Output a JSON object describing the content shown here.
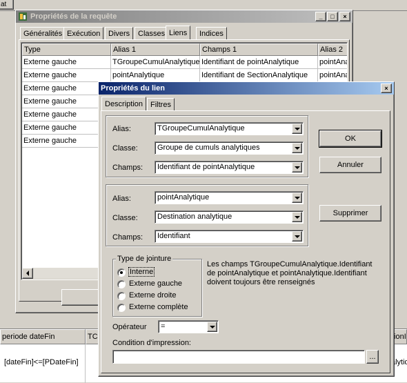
{
  "bg_top": {
    "tab_fragment": "at"
  },
  "query_window": {
    "title": "Propriétés de la requête",
    "tabs": [
      "Généralités",
      "Exécution",
      "Divers",
      "Classes",
      "Liens",
      "Indices"
    ],
    "selected_tab": "Liens",
    "columns": [
      "Type",
      "Alias 1",
      "Champs 1",
      "Alias 2"
    ],
    "rows": [
      [
        "Externe gauche",
        "TGroupeCumulAnalytique",
        "Identifiant de pointAnalytique",
        "pointAna"
      ],
      [
        "Externe gauche",
        "pointAnalytique",
        "Identifiant de SectionAnalytique",
        "pointAna"
      ],
      [
        "Externe gauche",
        "",
        "",
        ""
      ],
      [
        "Externe gauche",
        "",
        "",
        ""
      ],
      [
        "Externe gauche",
        "",
        "",
        ""
      ],
      [
        "Externe gauche",
        "",
        "",
        ""
      ],
      [
        "Externe gauche",
        "",
        "",
        ""
      ]
    ]
  },
  "bottom_grid": {
    "col1_header": "periode dateFin",
    "col2_header": "TC",
    "col_right_header": "tionI",
    "cell_value": "[dateFin]<=[PDateFin]",
    "cell_right": "alytiq"
  },
  "link_dialog": {
    "title": "Propriétés du lien",
    "tabs": [
      "Description",
      "Filtres"
    ],
    "group1": {
      "alias_label": "Alias:",
      "alias_value": "TGroupeCumulAnalytique",
      "classe_label": "Classe:",
      "classe_value": "Groupe de cumuls analytiques",
      "champs_label": "Champs:",
      "champs_value": "Identifiant de pointAnalytique"
    },
    "group2": {
      "alias_label": "Alias:",
      "alias_value": "pointAnalytique",
      "classe_label": "Classe:",
      "classe_value": "Destination analytique",
      "champs_label": "Champs:",
      "champs_value": "Identifiant"
    },
    "buttons": {
      "ok": "OK",
      "cancel": "Annuler",
      "delete": "Supprimer"
    },
    "jointure": {
      "legend": "Type de jointure",
      "options": [
        "Interne",
        "Externe gauche",
        "Externe droite",
        "Externe complète"
      ],
      "selected": "Interne"
    },
    "info_text": "Les champs TGroupeCumulAnalytique.Identifiant de pointAnalytique et pointAnalytique.Identifiant doivent toujours être renseignés",
    "operator_label": "Opérateur",
    "operator_value": "=",
    "condition_label": "Condition d'impression:",
    "condition_value": "",
    "browse_label": "..."
  }
}
